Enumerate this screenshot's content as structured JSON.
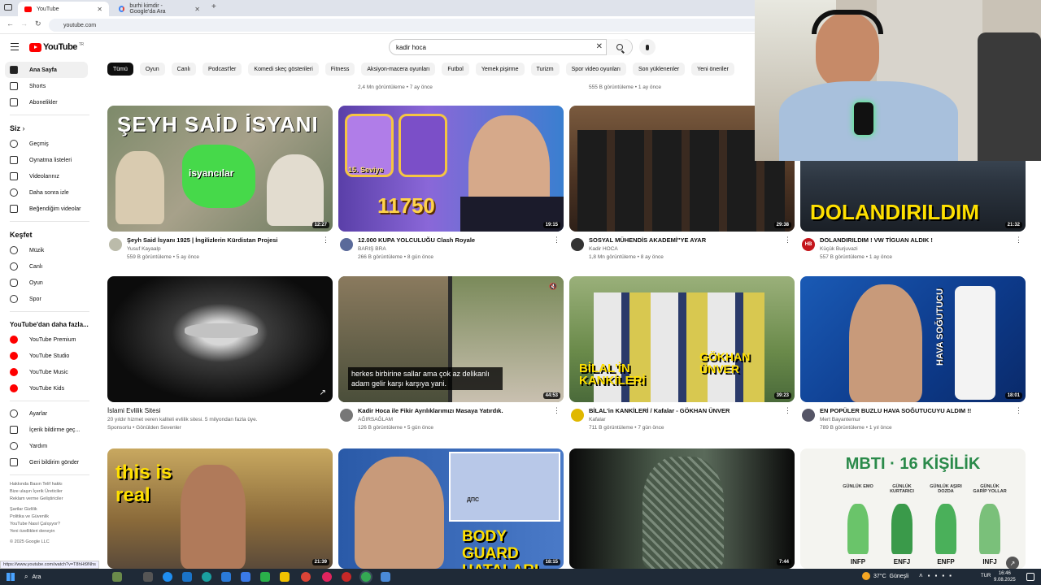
{
  "browser": {
    "tabs": [
      {
        "title": "YouTube",
        "active": true
      },
      {
        "title": "burhi kimdir - Google'da Ara",
        "active": false
      }
    ],
    "url": "youtube.com",
    "status_url": "https://www.youtube.com/watch?v=T8hHt9Nhs"
  },
  "header": {
    "logo": "YouTube",
    "logo_country": "TR",
    "search_value": "kadir hoca"
  },
  "sidebar": {
    "main": [
      "Ana Sayfa",
      "Shorts",
      "Abonelikler"
    ],
    "you_label": "Siz",
    "you": [
      "Geçmiş",
      "Oynatma listeleri",
      "Videolarınız",
      "Daha sonra izle",
      "Beğendiğim videolar"
    ],
    "explore_label": "Keşfet",
    "explore": [
      "Müzik",
      "Canlı",
      "Oyun",
      "Spor"
    ],
    "more_label": "YouTube'dan daha fazla...",
    "more": [
      "YouTube Premium",
      "YouTube Studio",
      "YouTube Music",
      "YouTube Kids"
    ],
    "settings": [
      "Ayarlar",
      "İçerik bildirme geç...",
      "Yardım",
      "Geri bildirim gönder"
    ],
    "footer1": "Hakkında  Basın  Telif hakkı\nBize ulaşın  İçerik Üreticiler\nReklam verme  Geliştiriciler",
    "footer2": "Şartlar  Gizlilik\nPolitika ve Güvenlik\nYouTube Nasıl Çalışıyor?\nYeni özellikleri deneyin",
    "copyright": "© 2025 Google LLC"
  },
  "chips": [
    "Tümü",
    "Oyun",
    "Canlı",
    "Podcast'ler",
    "Komedi skeç gösterileri",
    "Fitness",
    "Aksiyon-macera oyunları",
    "Futbol",
    "Yemek pişirme",
    "Turizm",
    "Spor video oyunları",
    "Son yüklenenler",
    "Yeni öneriler"
  ],
  "prev_stats": [
    "2,4 Mn görüntüleme • 7 ay önce",
    "555 B görüntüleme • 1 ay önce"
  ],
  "videos_row1": [
    {
      "title": "Şeyh Said İsyanı 1925 | İngilizlerin Kürdistan Projesi",
      "channel": "Yusuf Kayaalp",
      "stats": "559 B görüntüleme • 5 ay önce",
      "duration": "12:27",
      "thumb_text": "ŞEYH SAİD İSYANI",
      "thumb_sub": "isyancılar"
    },
    {
      "title": "12.000 KUPA YOLCULUĞU Clash Royale",
      "channel": "BARIŞ BRA",
      "stats": "266 B görüntüleme • 8 gün önce",
      "duration": "19:15",
      "thumb_text": "11750",
      "thumb_sub": "15. Seviye"
    },
    {
      "title": "SOSYAL MÜHENDİS AKADEMİ\"YE AYAR",
      "channel": "Kadir HOCA",
      "stats": "1,8 Mn görüntüleme • 8 ay önce",
      "duration": "29:38"
    },
    {
      "title": "DOLANDIRILDIM ! VW TİGUAN ALDIK !",
      "channel": "Küçük Burjuvazi",
      "stats": "557 B görüntüleme • 1 ay önce",
      "duration": "21:32",
      "thumb_text": "DOLANDIRILDIM",
      "avatar_text": "HB"
    }
  ],
  "videos_row2": [
    {
      "title": "İslami Evlilik Sitesi",
      "channel": "20 yıldır hizmet veren kaliteli evlilik sitesi. 5 milyondan fazla üye.",
      "stats": "Sponsorlu • Gönülden Sevenler",
      "sponsored_label": "Sponsorlu"
    },
    {
      "title": "Kadir Hoca ile Fikir Ayrılıklarımızı Masaya Yatırdık.",
      "channel": "AĞIRSAĞLAM",
      "stats": "126 B görüntüleme • 5 gün önce",
      "duration": "44:53",
      "caption": "herkes birbirine sallar ama çok az delikanlı adam gelir karşı karşıya yani."
    },
    {
      "title": "BİLAL'in KANKİLERİ / Kafalar - GÖKHAN ÜNVER",
      "channel": "Kafalar",
      "stats": "711 B görüntüleme • 7 gün önce",
      "duration": "39:23",
      "thumb_text": "BİLAL'İN KANKİLERİ",
      "thumb_sub": "GÖKHAN ÜNVER"
    },
    {
      "title": "EN POPÜLER BUZLU HAVA SOĞUTUCUYU ALDIM !!",
      "channel": "Mert Bayantemur",
      "stats": "789 B görüntüleme • 1 yıl önce",
      "duration": "18:01",
      "thumb_text": "HAVA SOĞUTUCU"
    }
  ],
  "videos_row3": [
    {
      "duration": "21:39",
      "thumb_text": "this is real"
    },
    {
      "duration": "18:15",
      "thumb_text": "BODY GUARD HATALARI",
      "sign_text": "ДПС"
    },
    {
      "duration": "7:44"
    },
    {
      "thumb_text": "MBTI · 16 KİŞİLİK",
      "types": [
        "INFP",
        "ENFJ",
        "ENFP",
        "INFJ"
      ],
      "subs": [
        "GÜNLÜK EMO",
        "GÜNLÜK KURTARICI",
        "GÜNLÜK AŞIRI DOZDA",
        "GÜNLÜK GARİP YOLLAR"
      ]
    }
  ],
  "taskbar": {
    "search": "Ara",
    "weather": "37°C  Güneşli",
    "lang": "TUR",
    "time": "16:46",
    "date": "9.08.2025"
  }
}
